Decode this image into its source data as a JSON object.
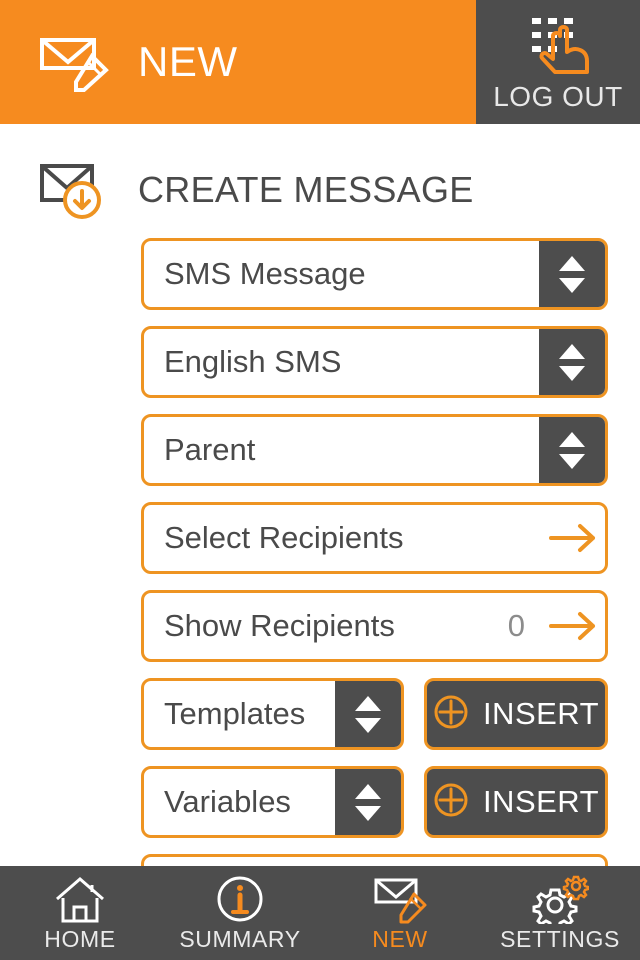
{
  "header": {
    "title": "NEW",
    "compose_icon": "envelope-pencil-icon",
    "logout_label": "LOG OUT",
    "logout_icon": "hand-pointer-keypad-icon"
  },
  "section": {
    "title": "CREATE MESSAGE",
    "icon": "envelope-download-icon"
  },
  "form": {
    "rows": [
      {
        "label": "SMS Message",
        "control": "stepper"
      },
      {
        "label": "English SMS",
        "control": "stepper"
      },
      {
        "label": "Parent",
        "control": "stepper"
      },
      {
        "label": "Select Recipients",
        "control": "arrow"
      },
      {
        "label": "Show Recipients",
        "control": "arrow",
        "count": "0"
      },
      {
        "label": "Templates",
        "control": "stepper-insert",
        "insert_label": "INSERT"
      },
      {
        "label": "Variables",
        "control": "stepper-insert",
        "insert_label": "INSERT"
      }
    ]
  },
  "nav": {
    "items": [
      {
        "label": "HOME",
        "icon": "home-icon",
        "active": false
      },
      {
        "label": "SUMMARY",
        "icon": "info-circle-icon",
        "active": false
      },
      {
        "label": "NEW",
        "icon": "envelope-pencil-icon",
        "active": true
      },
      {
        "label": "SETTINGS",
        "icon": "gears-icon",
        "active": false
      }
    ]
  },
  "colors": {
    "brand_orange": "#F68B1F",
    "border_orange": "#EE9422",
    "dark_gray": "#4d4d4d",
    "text_gray": "#4a4a4a"
  }
}
